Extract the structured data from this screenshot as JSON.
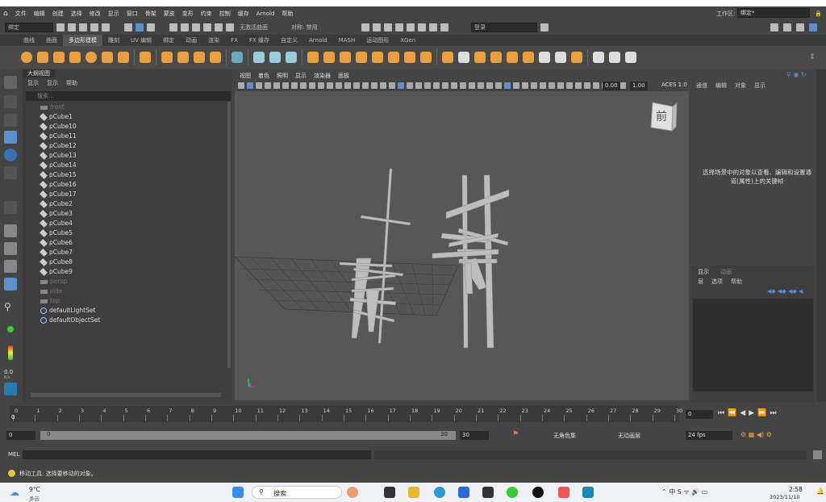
{
  "menu": [
    "文件",
    "编辑",
    "创建",
    "选择",
    "修改",
    "显示",
    "窗口",
    "骨架",
    "蒙皮",
    "变形",
    "约束",
    "控制",
    "缓存",
    "Arnold",
    "帮助"
  ],
  "workspace": {
    "label": "工作区:",
    "value": "绑定*"
  },
  "toolbar": {
    "mode": "绑定",
    "live_surface": "无激活曲面",
    "symmetry": "对称: 禁用",
    "login": "登录"
  },
  "shelf_tabs": [
    "曲线",
    "曲面",
    "多边形建模",
    "雕刻",
    "UV 编辑",
    "绑定",
    "动画",
    "渲染",
    "FX",
    "FX 缓存",
    "自定义",
    "Arnold",
    "MASH",
    "运动图形",
    "XGen"
  ],
  "active_shelf": "多边形建模",
  "outliner": {
    "title": "大纲视图",
    "menus": [
      "显示",
      "显示",
      "帮助"
    ],
    "search_placeholder": "搜索...",
    "items": [
      {
        "name": "front",
        "type": "camera"
      },
      {
        "name": "pCube1",
        "type": "mesh"
      },
      {
        "name": "pCube10",
        "type": "mesh"
      },
      {
        "name": "pCube11",
        "type": "mesh"
      },
      {
        "name": "pCube12",
        "type": "mesh"
      },
      {
        "name": "pCube13",
        "type": "mesh"
      },
      {
        "name": "pCube14",
        "type": "mesh"
      },
      {
        "name": "pCube15",
        "type": "mesh"
      },
      {
        "name": "pCube16",
        "type": "mesh"
      },
      {
        "name": "pCube17",
        "type": "mesh"
      },
      {
        "name": "pCube2",
        "type": "mesh"
      },
      {
        "name": "pCube3",
        "type": "mesh"
      },
      {
        "name": "pCube4",
        "type": "mesh"
      },
      {
        "name": "pCube5",
        "type": "mesh"
      },
      {
        "name": "pCube6",
        "type": "mesh"
      },
      {
        "name": "pCube7",
        "type": "mesh"
      },
      {
        "name": "pCube8",
        "type": "mesh"
      },
      {
        "name": "pCube9",
        "type": "mesh"
      },
      {
        "name": "persp",
        "type": "camera"
      },
      {
        "name": "side",
        "type": "camera"
      },
      {
        "name": "top",
        "type": "camera"
      },
      {
        "name": "defaultLightSet",
        "type": "set"
      },
      {
        "name": "defaultObjectSet",
        "type": "set"
      }
    ]
  },
  "viewport": {
    "menus": [
      "视图",
      "着色",
      "照明",
      "显示",
      "渲染器",
      "面板"
    ],
    "exposure": "0.00",
    "gamma": "1.00",
    "colorspace": "ACES 1.0",
    "viewcube_label": "前"
  },
  "channel_box": {
    "menus": [
      "通道",
      "编辑",
      "对象",
      "显示"
    ],
    "message": "选择场景中的对象以查看、编辑和设置通道(属性)上的关键帧",
    "tabs": [
      "显示",
      "动画"
    ],
    "sub_menus": [
      "层",
      "选项",
      "帮助"
    ]
  },
  "timeline": {
    "ticks": [
      "0",
      "1",
      "2",
      "3",
      "4",
      "5",
      "6",
      "7",
      "8",
      "9",
      "10",
      "11",
      "12",
      "13",
      "14",
      "15",
      "16",
      "17",
      "18",
      "19",
      "20",
      "21",
      "22",
      "23",
      "24",
      "25",
      "26",
      "27",
      "28",
      "29",
      "30"
    ],
    "current_frame": "0",
    "frame_field": "0"
  },
  "range": {
    "start": "0",
    "inner_start": "0",
    "inner_end": "30",
    "end": "30",
    "character_set": "无角色集",
    "anim_layer": "无动画层",
    "fps": "24 fps"
  },
  "mel": {
    "label": "MEL"
  },
  "help_line": "移动工具: 选择要移动的对象。",
  "taskbar": {
    "temp": "9°C",
    "weather": "多云",
    "search": "搜索",
    "time": "2:58",
    "date": "2023/11/10"
  },
  "left_readout": {
    "value": "0.0",
    "unit": "K/s"
  }
}
